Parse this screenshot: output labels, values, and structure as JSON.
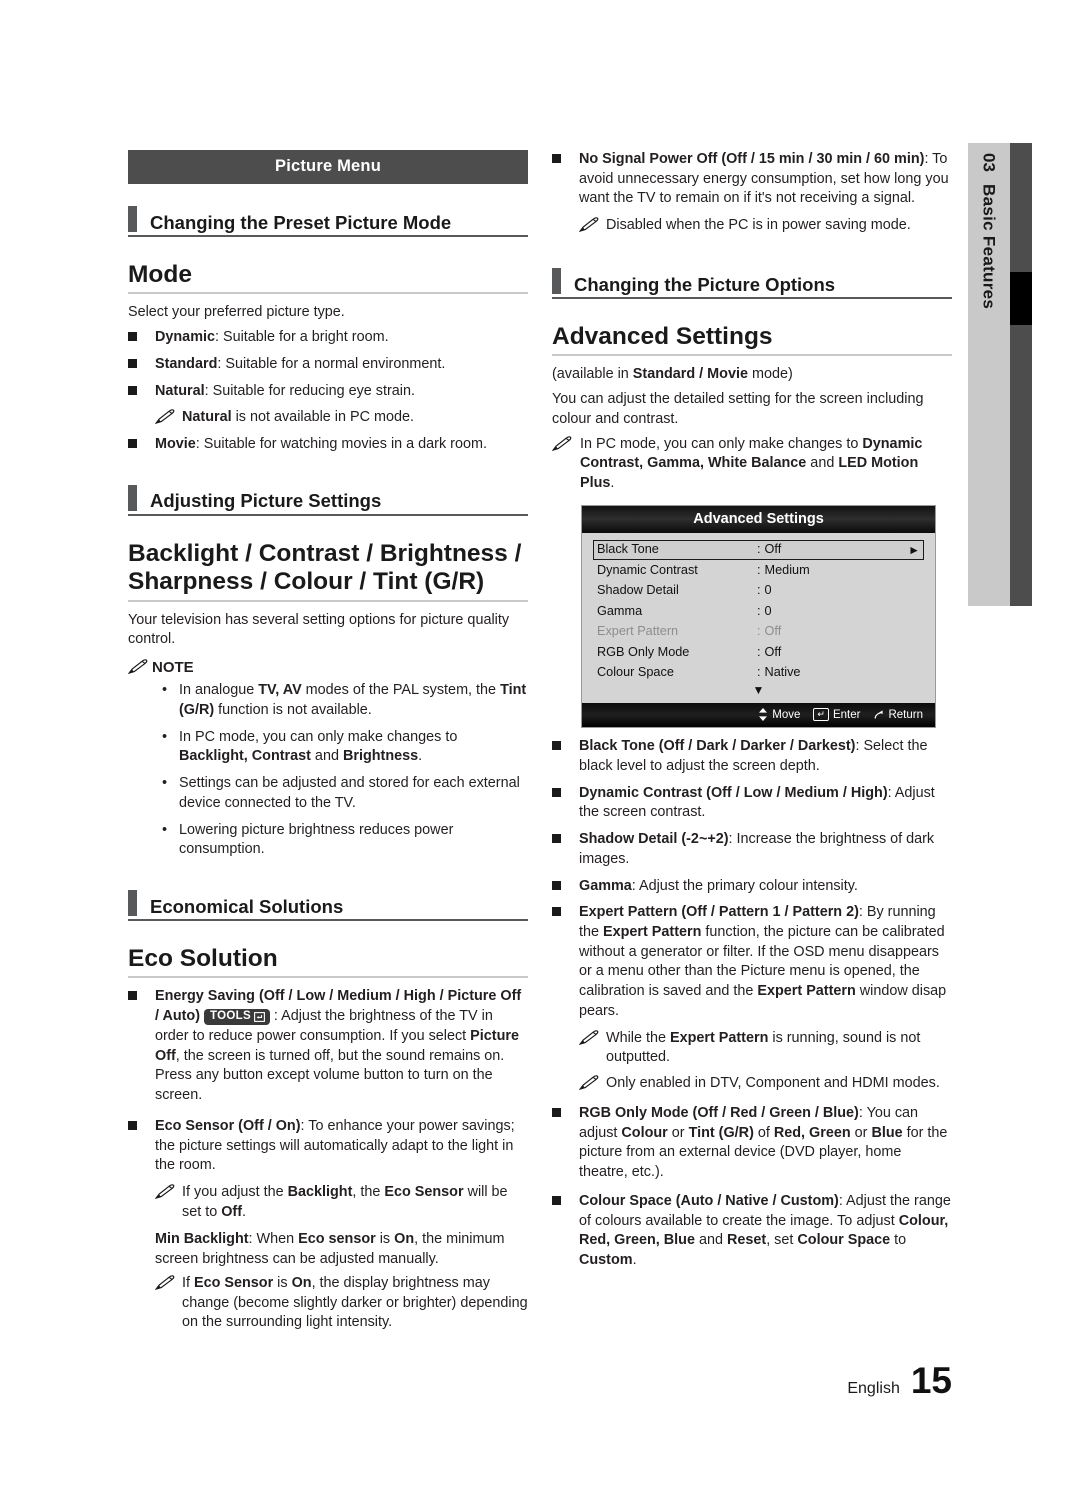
{
  "chapter_tab": {
    "number": "03",
    "label": "Basic Features"
  },
  "footer": {
    "language": "English",
    "page_number": "15"
  },
  "left_column": {
    "banner": "Picture Menu",
    "section_1": {
      "heading": "Changing the Preset Picture Mode",
      "topic": "Mode",
      "intro": "Select your preferred picture type.",
      "items": [
        {
          "term": "Dynamic",
          "desc": ": Suitable for a bright room."
        },
        {
          "term": "Standard",
          "desc": ": Suitable for a normal environment."
        },
        {
          "term": "Natural",
          "desc": ": Suitable for reducing eye strain."
        },
        {
          "term": "Movie",
          "desc": ": Suitable for watching movies in a dark room."
        }
      ],
      "natural_note_bold": "Natural",
      "natural_note_rest": " is not available in PC mode."
    },
    "section_2": {
      "heading": "Adjusting Picture Settings",
      "topic_line1": "Backlight / Contrast / Brightness /",
      "topic_line2": "Sharpness / Colour / Tint (G/R)",
      "intro": "Your television has several setting options for picture quality control.",
      "note_label": "NOTE",
      "notes": [
        {
          "pre": "In analogue ",
          "b1": "TV, AV",
          "mid": " modes of the PAL system, the ",
          "b2": "Tint (G/R)",
          "post": " function is not available."
        },
        {
          "pre": "In PC mode, you can only make changes to ",
          "b1": "Backlight, Contrast",
          "mid": " and ",
          "b2": "Brightness",
          "post": "."
        },
        {
          "pre": "Settings can be adjusted and stored for each external device connected to the TV.",
          "b1": "",
          "mid": "",
          "b2": "",
          "post": ""
        },
        {
          "pre": "Lowering picture brightness reduces power consumption.",
          "b1": "",
          "mid": "",
          "b2": "",
          "post": ""
        }
      ]
    },
    "section_3": {
      "heading": "Economical Solutions",
      "topic": "Eco Solution",
      "energy_saving_term": "Energy Saving (Off / Low / Medium / High / Picture Off / Auto)",
      "tools_label": "TOOLS",
      "energy_saving_desc_1": " : Adjust the brightness of the TV in order to reduce power consumption. If you select ",
      "energy_saving_bold": "Picture Off",
      "energy_saving_desc_2": ", the screen is turned off, but the sound remains on. Press any button except volume button to turn on the screen.",
      "eco_sensor_term": "Eco Sensor (Off / On)",
      "eco_sensor_desc": ": To enhance your power savings; the picture settings will automatically adapt to the light in the room.",
      "eco_sensor_note": {
        "pre": "If you adjust the ",
        "b1": "Backlight",
        "mid": ", the ",
        "b2": "Eco Sensor",
        "post": " will be set to ",
        "b3": "Off",
        "end": "."
      },
      "min_backlight_term": "Min Backlight",
      "min_backlight_desc": {
        "pre": ": When ",
        "b1": "Eco sensor",
        "mid": " is ",
        "b2": "On",
        "post": ", the minimum screen brightness can be adjusted manually."
      },
      "min_backlight_note": {
        "pre": "If ",
        "b1": "Eco Sensor",
        "mid": " is ",
        "b2": "On",
        "post": ", the display brightness may change (become slightly darker or brighter) depending on the surrounding light intensity."
      }
    }
  },
  "right_column": {
    "no_signal": {
      "term": "No Signal Power Off (Off / 15 min / 30 min / 60 min)",
      "desc": ": To avoid unnecessary energy consumption, set how long you want the TV to remain on if it's not receiving a signal.",
      "note": "Disabled when the PC is in power saving mode."
    },
    "section_heading": "Changing the Picture Options",
    "topic": "Advanced Settings",
    "availability_pre": "(available in ",
    "availability_bold": "Standard / Movie",
    "availability_post": " mode)",
    "intro": "You can adjust the detailed setting for the screen including colour and contrast.",
    "pc_note": {
      "pre": "In PC mode, you can only make changes to ",
      "b1": "Dynamic Contrast, Gamma, White Balance",
      "mid": " and ",
      "b2": "LED Motion Plus",
      "post": "."
    },
    "osd": {
      "title": "Advanced Settings",
      "rows": [
        {
          "label": "Black Tone",
          "value": "Off",
          "selected": true,
          "dim": false
        },
        {
          "label": "Dynamic Contrast",
          "value": "Medium",
          "selected": false,
          "dim": false
        },
        {
          "label": "Shadow Detail",
          "value": "0",
          "selected": false,
          "dim": false
        },
        {
          "label": "Gamma",
          "value": "0",
          "selected": false,
          "dim": false
        },
        {
          "label": "Expert Pattern",
          "value": "Off",
          "selected": false,
          "dim": true
        },
        {
          "label": "RGB Only Mode",
          "value": "Off",
          "selected": false,
          "dim": false
        },
        {
          "label": "Colour Space",
          "value": "Native",
          "selected": false,
          "dim": false
        }
      ],
      "scroll_indicator": "▼",
      "footer": {
        "move": "Move",
        "enter": "Enter",
        "return": "Return"
      }
    },
    "options": [
      {
        "term": "Black Tone (Off / Dark / Darker / Darkest)",
        "desc": ": Select the black level to adjust the screen depth."
      },
      {
        "term": "Dynamic Contrast (Off / Low / Medium / High)",
        "desc": ": Adjust the screen contrast."
      },
      {
        "term": "Shadow Detail (-2~+2)",
        "desc": ": Increase the brightness of dark images."
      },
      {
        "term": "Gamma",
        "desc": ": Adjust the primary colour intensity."
      }
    ],
    "expert_pattern": {
      "term": "Expert Pattern (Off / Pattern 1 / Pattern 2)",
      "d1": ": By running the ",
      "b1": "Expert Pattern",
      "d2": " function, the picture can be calibrated without a generator or filter. If the OSD menu disappears or a menu other than the Picture menu is opened, the calibration is saved and the ",
      "b2": "Expert Pattern",
      "d3": " window disap pears.",
      "note_1": {
        "pre": "While the ",
        "b1": "Expert Pattern",
        "post": " is running, sound is not outputted."
      },
      "note_2": "Only enabled in DTV, Component and HDMI modes."
    },
    "rgb_only": {
      "term": "RGB Only Mode (Off / Red / Green / Blue)",
      "d1": ": You can adjust ",
      "b1": "Colour",
      "d2": " or ",
      "b2": "Tint (G/R)",
      "d3": " of ",
      "b3": "Red, Green",
      "d4": " or ",
      "b4": "Blue",
      "d5": " for the picture from an external device (DVD player, home theatre, etc.)."
    },
    "colour_space": {
      "term": "Colour Space (Auto / Native / Custom)",
      "d1": ": Adjust the range of colours available to create the image. To adjust ",
      "b1": "Colour, Red, Green, Blue",
      "d2": " and ",
      "b2": "Reset",
      "d3": ", set ",
      "b3": "Colour Space",
      "d4": " to ",
      "b4": "Custom",
      "d5": "."
    }
  }
}
